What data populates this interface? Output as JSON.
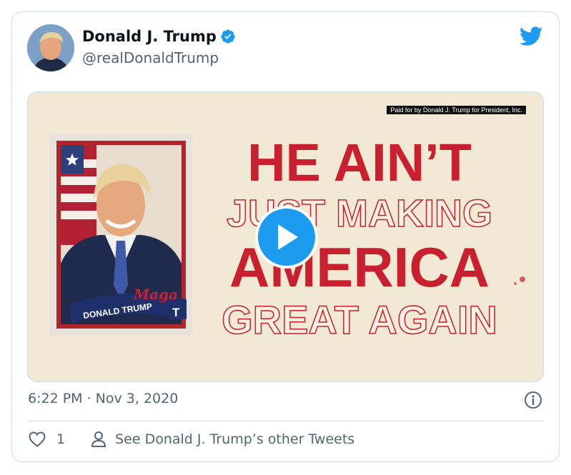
{
  "tweet": {
    "display_name": "Donald J. Trump",
    "handle": "@realDonaldTrump",
    "timestamp": "6:22 PM · Nov 3, 2020",
    "like_count": "1",
    "other_tweets_link": "See Donald J. Trump’s other Tweets"
  },
  "media": {
    "disclaimer": "Paid for by Donald J. Trump for President, Inc.",
    "headline_1": "HE AIN’T",
    "headline_2": "JUST MAKING",
    "headline_3": "AMERICA",
    "headline_4": "GREAT AGAIN",
    "card_script": "Maga",
    "card_banner": "DONALD TRUMP",
    "card_letter": "T"
  },
  "colors": {
    "verified_blue": "#1d9bf0",
    "text_secondary": "#536471",
    "headline_red": "#c8202e",
    "media_background": "#f2e9d4"
  },
  "icons": [
    "verified-badge-icon",
    "twitter-bird-icon",
    "play-icon",
    "info-icon",
    "heart-icon",
    "person-icon"
  ]
}
